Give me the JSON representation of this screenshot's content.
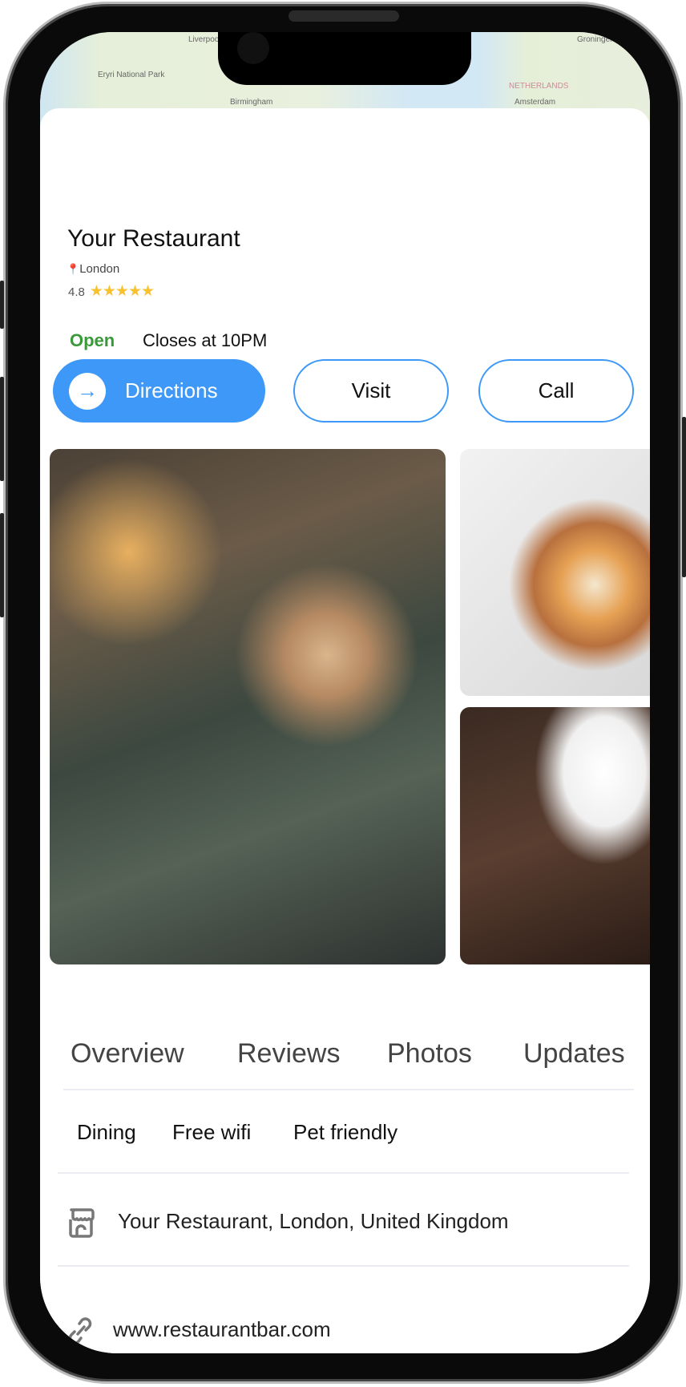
{
  "map": {
    "labels": [
      "Liverpool",
      "Eryri National Park",
      "Birmingham",
      "Groningen",
      "NETHERLANDS",
      "Amsterdam"
    ]
  },
  "place": {
    "name": "Your Restaurant",
    "location": "London",
    "rating": "4.8",
    "stars": "★★★★★",
    "rating_value": 4.8,
    "status": "Open",
    "hours": "Closes at 10PM",
    "status_color": "#3a9a3a"
  },
  "actions": {
    "directions": "Directions",
    "visit": "Visit",
    "call": "Call",
    "accent": "#3d98f7"
  },
  "tabs": [
    "Overview",
    "Reviews",
    "Photos",
    "Updates"
  ],
  "amenities": [
    "Dining",
    "Free wifi",
    "Pet friendly"
  ],
  "details": {
    "address": "Your Restaurant,  London, United Kingdom",
    "website": "www.restaurantbar.com",
    "address_icon": "storefront-icon",
    "website_icon": "link-icon"
  }
}
